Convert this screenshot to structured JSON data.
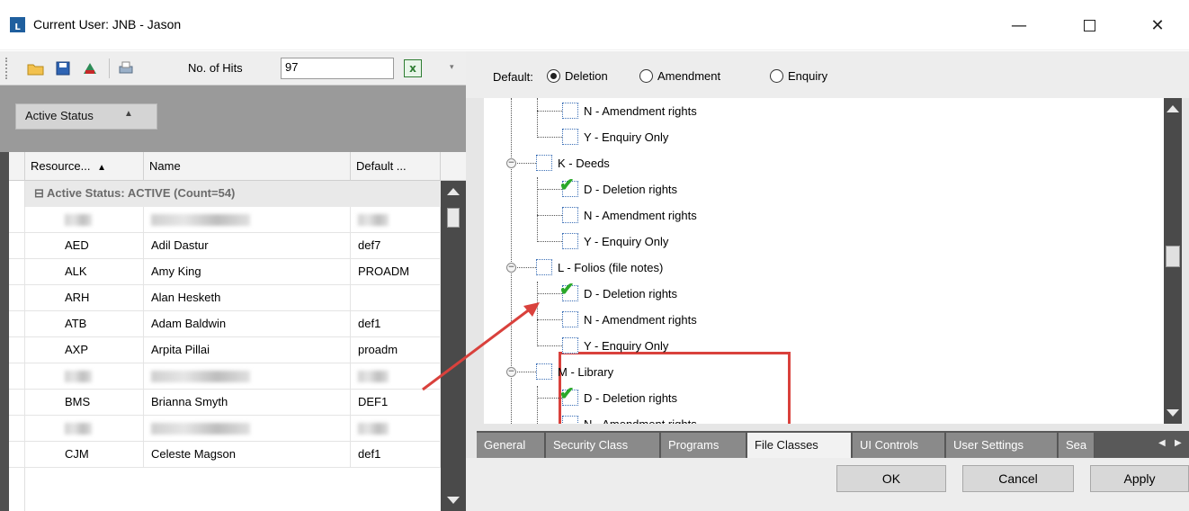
{
  "window": {
    "title": "Current User: JNB - Jason",
    "minimize_glyph": "—",
    "close_glyph": "✕"
  },
  "toolbar": {
    "hits_label": "No. of Hits",
    "hits_value": "97",
    "icons": [
      "open-folder-icon",
      "save-icon",
      "user-remove-icon",
      "print-icon",
      "excel-export-icon"
    ]
  },
  "grouping": {
    "chip_label": "Active Status",
    "sort_glyph": "▲"
  },
  "grid": {
    "columns": [
      "Resource...",
      "Name",
      "Default ..."
    ],
    "sort_glyph": "▲",
    "group_label": "⊟ Active Status: ACTIVE (Count=54)",
    "rows": [
      {
        "code": "",
        "name": "",
        "default": "",
        "redacted": true
      },
      {
        "code": "AED",
        "name": "Adil Dastur",
        "default": "def7"
      },
      {
        "code": "ALK",
        "name": "Amy King",
        "default": "PROADM"
      },
      {
        "code": "ARH",
        "name": "Alan Hesketh",
        "default": ""
      },
      {
        "code": "ATB",
        "name": "Adam Baldwin",
        "default": "def1"
      },
      {
        "code": "AXP",
        "name": "Arpita Pillai",
        "default": "proadm"
      },
      {
        "code": "",
        "name": "",
        "default": "",
        "redacted": true
      },
      {
        "code": "BMS",
        "name": "Brianna Smyth",
        "default": "DEF1"
      },
      {
        "code": "",
        "name": "",
        "default": "",
        "redacted": true
      },
      {
        "code": "CJM",
        "name": "Celeste Magson",
        "default": "def1"
      }
    ]
  },
  "defaults": {
    "label": "Default:",
    "options": [
      {
        "label": "Deletion",
        "selected": true
      },
      {
        "label": "Amendment",
        "selected": false
      },
      {
        "label": "Enquiry",
        "selected": false
      }
    ]
  },
  "tree": {
    "nodes": [
      {
        "label": "N - Amendment rights",
        "checked": false
      },
      {
        "label": "Y - Enquiry Only",
        "checked": false
      },
      {
        "label": "K - Deeds",
        "checked": false,
        "parent": true
      },
      {
        "label": "D - Deletion rights",
        "checked": true
      },
      {
        "label": "N - Amendment rights",
        "checked": false
      },
      {
        "label": "Y - Enquiry Only",
        "checked": false
      },
      {
        "label": "L - Folios (file notes)",
        "checked": false,
        "parent": true
      },
      {
        "label": "D - Deletion rights",
        "checked": true
      },
      {
        "label": "N - Amendment rights",
        "checked": false
      },
      {
        "label": "Y - Enquiry Only",
        "checked": false
      },
      {
        "label": "M - Library",
        "checked": false,
        "parent": true
      },
      {
        "label": "D - Deletion rights",
        "checked": true
      },
      {
        "label": "N - Amendment rights",
        "checked": false
      }
    ],
    "check_glyph": "✔",
    "collapse_glyph": "−"
  },
  "tabs": {
    "items": [
      "General",
      "Security Class",
      "Programs",
      "File Classes",
      "UI Controls",
      "User Settings",
      "Sea"
    ],
    "active": "File Classes",
    "prev_glyph": "◀",
    "next_glyph": "▶"
  },
  "buttons": {
    "ok": "OK",
    "cancel": "Cancel",
    "apply": "Apply"
  },
  "colors": {
    "highlight": "#d9413c",
    "check": "#2aa82a",
    "dark_panel": "#505050"
  }
}
